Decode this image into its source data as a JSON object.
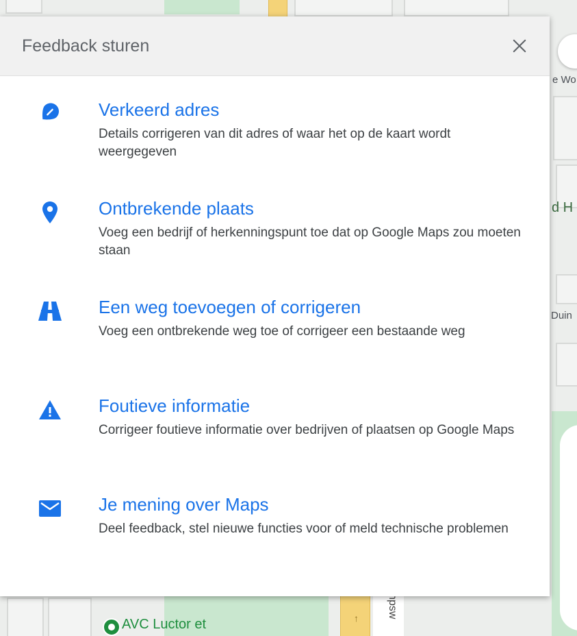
{
  "map": {
    "labels": {
      "top_right": "e Wo",
      "middle_right": "d H",
      "lower_right": "Duin",
      "street": "npsw",
      "poi": "AVC Luctor et"
    }
  },
  "dialog": {
    "title": "Feedback sturen",
    "close_icon": "close-icon",
    "options": [
      {
        "icon": "pin-edit-icon",
        "title": "Verkeerd adres",
        "description": "Details corrigeren van dit adres of waar het op de kaart wordt weergegeven"
      },
      {
        "icon": "place-pin-icon",
        "title": "Ontbrekende plaats",
        "description": "Voeg een bedrijf of herkenningspunt toe dat op Google Maps zou moeten staan"
      },
      {
        "icon": "road-icon",
        "title": "Een weg toevoegen of corrigeren",
        "description": "Voeg een ontbrekende weg toe of corrigeer een bestaande weg"
      },
      {
        "icon": "warning-icon",
        "title": "Foutieve informatie",
        "description": "Corrigeer foutieve informatie over bedrijven of plaatsen op Google Maps"
      },
      {
        "icon": "mail-icon",
        "title": "Je mening over Maps",
        "description": "Deel feedback, stel nieuwe functies voor of meld technische problemen"
      }
    ]
  },
  "colors": {
    "accent": "#1a73e8",
    "header_bg": "#f1f1f1",
    "map_park": "#c9e7cf",
    "map_road": "#f4d378"
  }
}
